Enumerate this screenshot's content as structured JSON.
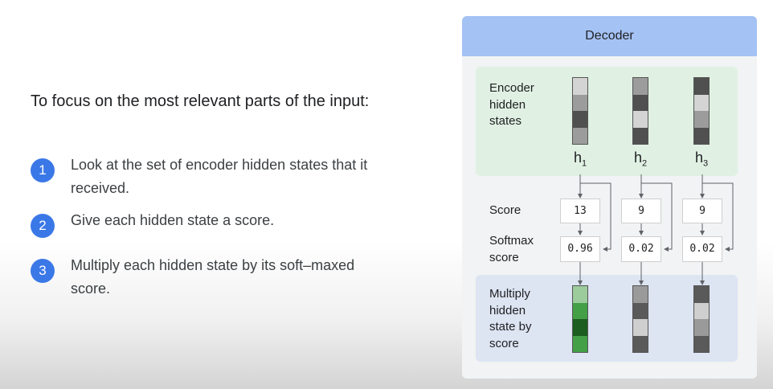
{
  "heading": "To focus on the most relevant parts of the input:",
  "steps": [
    {
      "num": "1",
      "text": "Look at the set of encoder hidden states that it received."
    },
    {
      "num": "2",
      "text": "Give each hidden state a score."
    },
    {
      "num": "3",
      "text": "Multiply each hidden state by its soft–maxed score."
    }
  ],
  "panel": {
    "title": "Decoder",
    "encoder_label": "Encoder hidden states",
    "score_label": "Score",
    "softmax_label": "Softmax score",
    "multiply_label": "Multiply hidden state by score",
    "hidden": [
      {
        "h": "h",
        "sub": "1",
        "score": "13",
        "softmax": "0.96"
      },
      {
        "h": "h",
        "sub": "2",
        "score": "9",
        "softmax": "0.02"
      },
      {
        "h": "h",
        "sub": "3",
        "score": "9",
        "softmax": "0.02"
      }
    ]
  },
  "colors": {
    "enc1": [
      "#d4d4d4",
      "#9c9c9c",
      "#505050",
      "#9c9c9c"
    ],
    "enc2": [
      "#9c9c9c",
      "#505050",
      "#d4d4d4",
      "#505050"
    ],
    "enc3": [
      "#505050",
      "#d4d4d4",
      "#9c9c9c",
      "#505050"
    ],
    "mul1": [
      "#9ccb9c",
      "#43a047",
      "#1b5e20",
      "#43a047"
    ],
    "mul2": [
      "#9a9a9a",
      "#5a5a5a",
      "#cfcfcf",
      "#5a5a5a"
    ],
    "mul3": [
      "#5a5a5a",
      "#cfcfcf",
      "#9a9a9a",
      "#5a5a5a"
    ]
  }
}
